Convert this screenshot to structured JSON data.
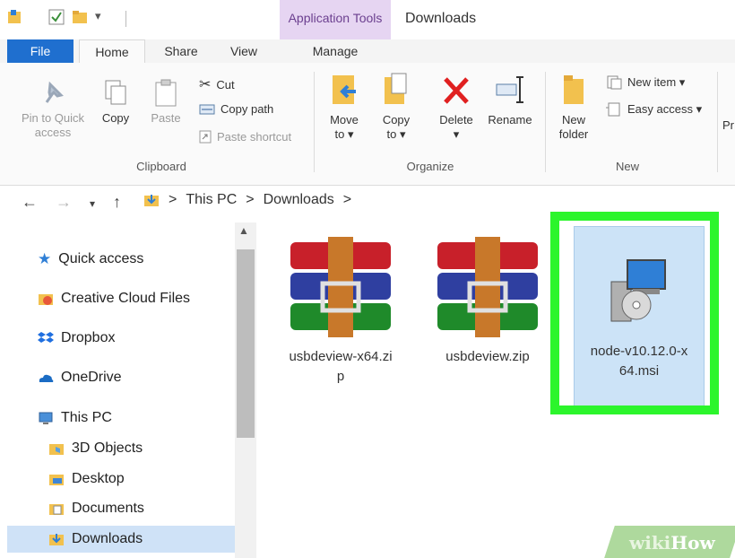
{
  "titlebar": {
    "context_tab_title": "Application Tools",
    "window_title": "Downloads"
  },
  "tabs": {
    "file": "File",
    "home": "Home",
    "share": "Share",
    "view": "View",
    "manage": "Manage"
  },
  "ribbon": {
    "pin": "Pin to Quick\naccess",
    "copy": "Copy",
    "paste": "Paste",
    "cut": "Cut",
    "copy_path": "Copy path",
    "paste_shortcut": "Paste shortcut",
    "clipboard_label": "Clipboard",
    "move_to": "Move\nto ▾",
    "copy_to": "Copy\nto ▾",
    "delete": "Delete\n▾",
    "rename": "Rename",
    "organize_label": "Organize",
    "new_folder": "New\nfolder",
    "new_item": "New item ▾",
    "easy_access": "Easy access ▾",
    "new_label": "New",
    "properties_partial": "Pr"
  },
  "address": {
    "crumbs": [
      "This PC",
      "Downloads"
    ]
  },
  "nav_pane": {
    "items": [
      {
        "label": "Quick access",
        "icon": "star-icon"
      },
      {
        "label": "Creative Cloud Files",
        "icon": "creative-cloud-icon"
      },
      {
        "label": "Dropbox",
        "icon": "dropbox-icon"
      },
      {
        "label": "OneDrive",
        "icon": "onedrive-icon"
      },
      {
        "label": "This PC",
        "icon": "computer-icon"
      },
      {
        "label": "3D Objects",
        "icon": "3d-objects-icon"
      },
      {
        "label": "Desktop",
        "icon": "desktop-folder-icon"
      },
      {
        "label": "Documents",
        "icon": "documents-icon"
      },
      {
        "label": "Downloads",
        "icon": "downloads-icon"
      }
    ]
  },
  "files": [
    {
      "name": "usbdeview-x64.zi\np",
      "icon": "winrar-archive-icon"
    },
    {
      "name": "usbdeview.zip",
      "icon": "winrar-archive-icon"
    },
    {
      "name": "node-v10.12.0-x\n64.msi",
      "icon": "msi-installer-icon",
      "selected": true
    }
  ],
  "watermark": {
    "wiki": "wiki",
    "how": "How"
  },
  "colors": {
    "file_tab": "#1f6fcf",
    "context_tab": "#e6d5f2",
    "selection": "#cce3f7",
    "highlight": "#2cf52c"
  }
}
